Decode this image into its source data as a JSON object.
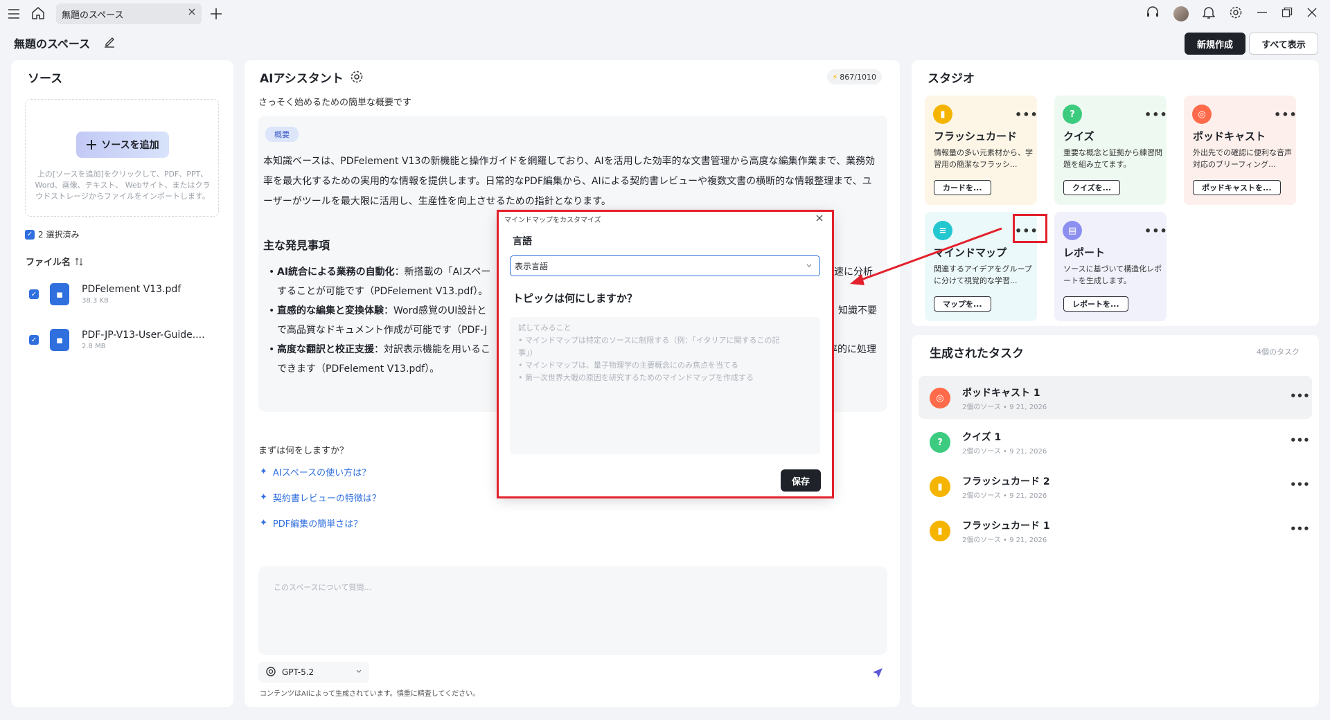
{
  "tab": {
    "title": "無題のスペース"
  },
  "header": {
    "space_title": "無題のスペース",
    "new_button": "新規作成",
    "view_all_button": "すべて表示"
  },
  "sources": {
    "title": "ソース",
    "add_button": "ソースを追加",
    "drop_hint": "上の[ソースを追加]をクリックして、PDF、PPT、Word、画像、テキスト、 Webサイト、またはクラウドストレージからファイルをインポートします。",
    "selected": "2 選択済み",
    "file_header": "ファイル名",
    "files": [
      {
        "name": "PDFelement V13.pdf",
        "size": "38.3 KB"
      },
      {
        "name": "PDF-JP-V13-User-Guide....",
        "size": "2.8 MB"
      }
    ]
  },
  "assistant": {
    "title": "AIアシスタント",
    "credits": "867/1010",
    "subtitle": "さっそく始めるための簡単な概要です",
    "pill": "概要",
    "summary": "本知識ベースは、PDFelement V13の新機能と操作ガイドを網羅しており、AIを活用した効率的な文書管理から高度な編集作業まで、業務効率を最大化するための実用的な情報を提供します。日常的なPDF編集から、AIによる契約書レビューや複数文書の横断的な情報整理まで、ユーザーがツールを最大限に活用し、生産性を向上させるための指針となります。",
    "findings_title": "主な発見事項",
    "bullets": [
      {
        "bold": "AI統合による業務の自動化",
        "left": "：新搭載の「AIスペー",
        "right": "迅速に分析",
        "line2": "することが可能です（PDFelement V13.pdf）。"
      },
      {
        "bold": "直感的な編集と変換体験",
        "left": "：Word感覚のUI設計と",
        "right": "知識不要",
        "line2": "で高品質なドキュメント作成が可能です（PDF-J"
      },
      {
        "bold": "高度な翻訳と校正支援",
        "left": "：対訳表示機能を用いるこ",
        "right": "率的に処理",
        "line2": "できます（PDFelement V13.pdf）。"
      }
    ],
    "question_title": "まずは何をしますか？",
    "questions": [
      "AIスペースの使い方は？",
      "契約書レビューの特徴は？",
      "PDF編集の簡単さは？"
    ],
    "chat_placeholder": "このスペースについて質問…",
    "model": "GPT-5.2",
    "disclaimer": "コンテンツはAIによって生成されています。慎重に精査してください。"
  },
  "studio": {
    "title": "スタジオ",
    "cards": [
      {
        "title": "フラッシュカード",
        "desc": "情報量の多い元素材から、学習用の簡潔なフラッシ...",
        "button": "カードを...",
        "icon": "flashcard-icon",
        "color": "#f5b400",
        "bg": "#fdf6e7"
      },
      {
        "title": "クイズ",
        "desc": "重要な概念と証拠から練習問題を組み立てます。",
        "button": "クイズを...",
        "icon": "quiz-icon",
        "color": "#3ccb7f",
        "bg": "#eef9f1"
      },
      {
        "title": "ポッドキャスト",
        "desc": "外出先での確認に便利な音声対応のブリーフィング...",
        "button": "ポッドキャストを...",
        "icon": "podcast-icon",
        "color": "#ff6b4a",
        "bg": "#fdf0ec"
      },
      {
        "title": "マインドマップ",
        "desc": "関連するアイデアをグループに分けて視覚的な学習...",
        "button": "マップを...",
        "icon": "mindmap-icon",
        "color": "#23c7cf",
        "bg": "#ecf9fa"
      },
      {
        "title": "レポート",
        "desc": "ソースに基づいて構造化レポートを生成します。",
        "button": "レポートを...",
        "icon": "report-icon",
        "color": "#8c8ff0",
        "bg": "#f1f1fc"
      }
    ]
  },
  "tasks": {
    "title": "生成されたタスク",
    "count": "4個のタスク",
    "items": [
      {
        "name": "ポッドキャスト 1",
        "meta": "2個のソース • 9 21, 2026",
        "color": "#ff6b4a"
      },
      {
        "name": "クイズ 1",
        "meta": "2個のソース • 9 21, 2026",
        "color": "#3ccb7f"
      },
      {
        "name": "フラッシュカード 2",
        "meta": "2個のソース • 9 21, 2026",
        "color": "#f5b400"
      },
      {
        "name": "フラッシュカード 1",
        "meta": "2個のソース • 9 21, 2026",
        "color": "#f5b400"
      }
    ]
  },
  "modal": {
    "title": "マインドマップをカスタマイズ",
    "language_label": "言語",
    "language_value": "表示言語",
    "topic_label": "トピックは何にしますか？",
    "placeholder_lines": [
      "試してみること",
      "• マインドマップは特定のソースに制限する（例：「イタリアに関するこの記",
      "事」）",
      "• マインドマップは、量子物理学の主要概念にのみ焦点を当てる",
      "• 第一次世界大戦の原因を研究するためのマインドマップを作成する"
    ],
    "save": "保存"
  },
  "colors": {
    "accent": "#2f6fde",
    "highlight": "#e3202b",
    "dark": "#1f2329"
  }
}
